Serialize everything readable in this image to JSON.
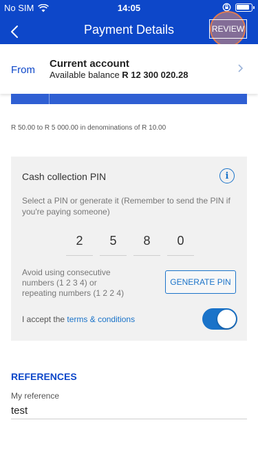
{
  "status_bar": {
    "carrier": "No SIM",
    "time": "14:05"
  },
  "header": {
    "title": "Payment Details",
    "review_label": "REVIEW"
  },
  "from": {
    "label": "From",
    "account_name": "Current account",
    "balance_prefix": "Available balance",
    "balance_value": "R 12 300 020.28"
  },
  "amount_hint": "R 50.00 to R 5 000.00 in denominations of R 10.00",
  "pin": {
    "title": "Cash collection PIN",
    "description": "Select a PIN or generate it (Remember to send the PIN if you're paying someone)",
    "digits": [
      "2",
      "5",
      "8",
      "0"
    ],
    "avoid_text": "Avoid using consecutive numbers (1 2 3 4) or repeating numbers (1 2 2 4)",
    "generate_label": "GENERATE PIN",
    "accept_prefix": "I accept the",
    "terms_link": "terms & conditions",
    "accepted": true
  },
  "references": {
    "heading": "REFERENCES",
    "my_reference_label": "My reference",
    "my_reference_value": "test"
  },
  "colors": {
    "brand": "#0d47c9",
    "accent": "#1a73c9",
    "highlight": "#e07b50"
  }
}
